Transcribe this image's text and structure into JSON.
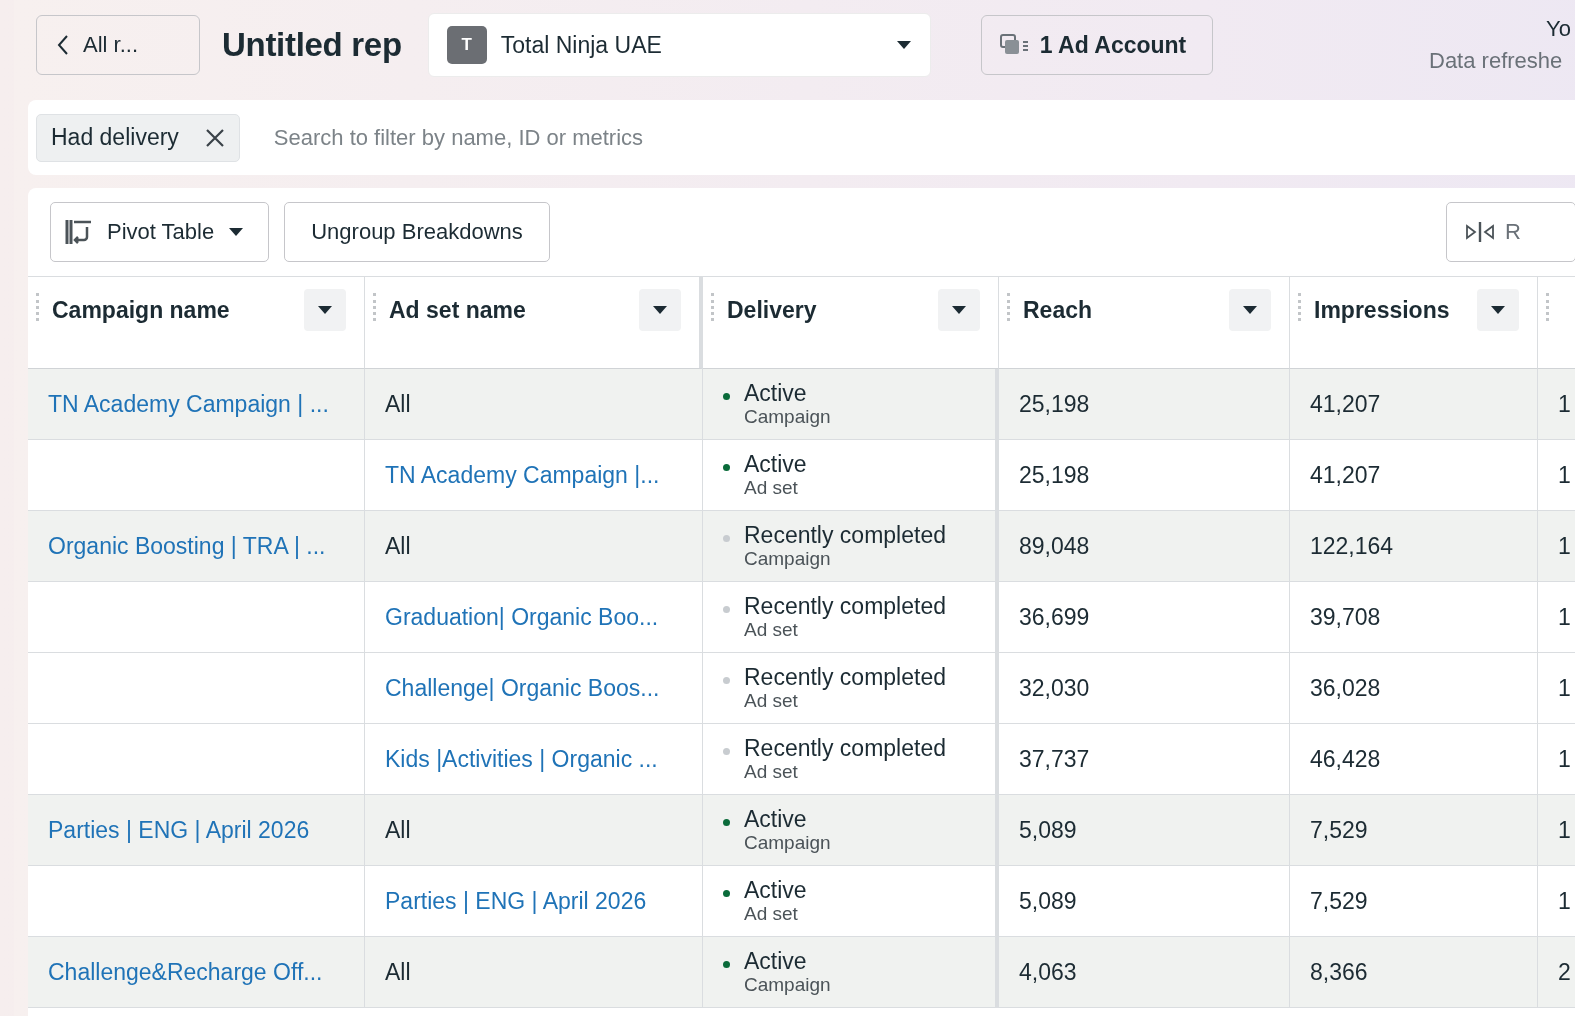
{
  "header": {
    "back_button": "All r...",
    "title": "Untitled rep",
    "account_select": {
      "avatar_letter": "T",
      "name": "Total Ninja UAE"
    },
    "ad_account_button": "1 Ad Account",
    "refresh_info": {
      "line_1": "Yo",
      "line_2": "Data refreshe"
    }
  },
  "filter": {
    "chip": "Had delivery",
    "placeholder": "Search to filter by name, ID or metrics"
  },
  "toolbar": {
    "pivot_button": "Pivot Table",
    "ungroup_button": "Ungroup Breakdowns",
    "right_button": "R"
  },
  "table": {
    "columns": [
      "Campaign name",
      "Ad set name",
      "Delivery",
      "Reach",
      "Impressions"
    ],
    "rows": [
      {
        "kind": "campaign",
        "campaign_name": "TN Academy Campaign | ...",
        "ad_set_name": "All",
        "delivery": {
          "status": "Active",
          "level_name": "Campaign",
          "color": "#0a6b3a"
        },
        "reach": "25,198",
        "impressions": "41,207",
        "column_6": "1"
      },
      {
        "kind": "adset",
        "ad_set_name": "TN Academy Campaign |...",
        "delivery": {
          "status": "Active",
          "level_name": "Ad set",
          "color": "#0a6b3a"
        },
        "reach": "25,198",
        "impressions": "41,207",
        "column_6": "1"
      },
      {
        "kind": "campaign",
        "campaign_name": "Organic Boosting | TRA | ...",
        "ad_set_name": "All",
        "delivery": {
          "status": "Recently completed",
          "level_name": "Campaign",
          "color": "#c8ccd0"
        },
        "reach": "89,048",
        "impressions": "122,164",
        "column_6": "1"
      },
      {
        "kind": "adset",
        "ad_set_name": "Graduation| Organic Boo...",
        "delivery": {
          "status": "Recently completed",
          "level_name": "Ad set",
          "color": "#c8ccd0"
        },
        "reach": "36,699",
        "impressions": "39,708",
        "column_6": "1"
      },
      {
        "kind": "adset",
        "ad_set_name": "Challenge| Organic Boos...",
        "delivery": {
          "status": "Recently completed",
          "level_name": "Ad set",
          "color": "#c8ccd0"
        },
        "reach": "32,030",
        "impressions": "36,028",
        "column_6": "1"
      },
      {
        "kind": "adset",
        "ad_set_name": "Kids |Activities | Organic ...",
        "delivery": {
          "status": "Recently completed",
          "level_name": "Ad set",
          "color": "#c8ccd0"
        },
        "reach": "37,737",
        "impressions": "46,428",
        "column_6": "1"
      },
      {
        "kind": "campaign",
        "campaign_name": "Parties | ENG | April 2026",
        "ad_set_name": "All",
        "delivery": {
          "status": "Active",
          "level_name": "Campaign",
          "color": "#0a6b3a"
        },
        "reach": "5,089",
        "impressions": "7,529",
        "column_6": "1"
      },
      {
        "kind": "adset",
        "ad_set_name": "Parties | ENG | April 2026",
        "delivery": {
          "status": "Active",
          "level_name": "Ad set",
          "color": "#0a6b3a"
        },
        "reach": "5,089",
        "impressions": "7,529",
        "column_6": "1"
      },
      {
        "kind": "campaign",
        "campaign_name": "Challenge&Recharge Off...",
        "ad_set_name": "All",
        "delivery": {
          "status": "Active",
          "level_name": "Campaign",
          "color": "#0a6b3a"
        },
        "reach": "4,063",
        "impressions": "8,366",
        "column_6": "2"
      }
    ]
  }
}
